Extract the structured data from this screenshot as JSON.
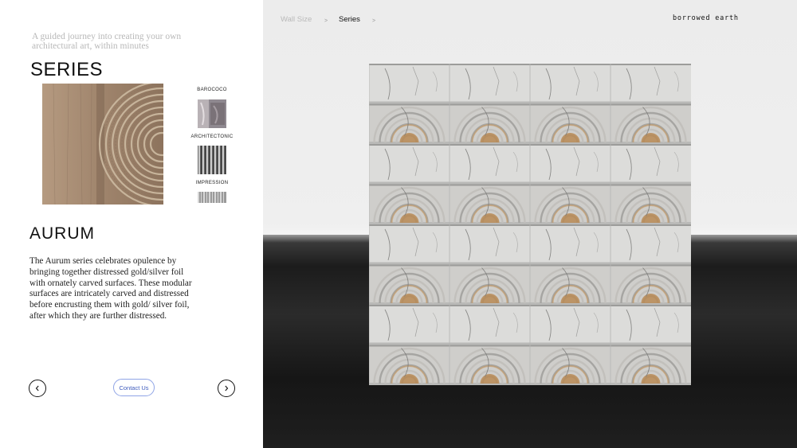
{
  "intro": {
    "tagline": "A guided journey into creating your own architectural art, within minutes"
  },
  "series": {
    "heading": "SERIES",
    "thumbnails": [
      {
        "label": "BAROCOCO"
      },
      {
        "label": "ARCHITECTONIC"
      },
      {
        "label": "IMPRESSION"
      }
    ],
    "selected": {
      "title": "AURUM",
      "description": "The Aurum series celebrates opulence by bringing together distressed gold/silver foil with ornately carved surfaces. These modular surfaces are intricately carved and distressed before encrusting them with gold/ silver foil, after which they are further distressed."
    }
  },
  "nav": {
    "prev_icon": "chevron-left-icon",
    "next_icon": "chevron-right-icon",
    "contact_label": "Contact Us"
  },
  "breadcrumb": {
    "steps": [
      {
        "label": "Wall Size",
        "state": "done"
      },
      {
        "label": "Series",
        "state": "current"
      }
    ],
    "separator": ">"
  },
  "brand": {
    "name": "borrowed earth"
  },
  "colors": {
    "accent": "#3e5bbd",
    "accent_border": "#8fa4e6",
    "heading": "#111111",
    "muted_text": "#b8b8b8",
    "floor": "#1c1c1c",
    "backdrop": "#ececec"
  }
}
